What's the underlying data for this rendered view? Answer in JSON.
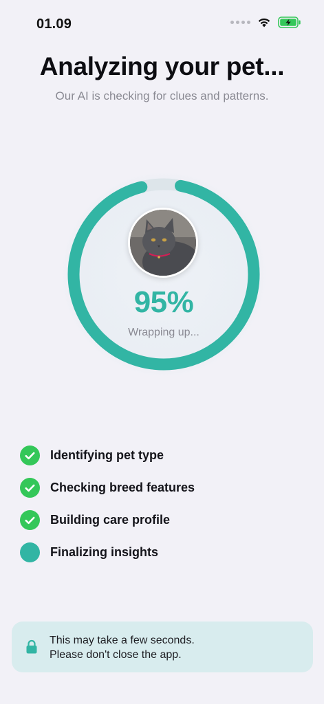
{
  "status_bar": {
    "time": "01.09",
    "icons": [
      "signal-dots-icon",
      "wifi-icon",
      "battery-charging-icon"
    ]
  },
  "header": {
    "title": "Analyzing your pet...",
    "subtitle": "Our AI is checking for clues and patterns."
  },
  "progress": {
    "value": 0.95,
    "percent_text": "95%",
    "status_text": "Wrapping up...",
    "color": "#32b5a4",
    "track_color": "#dde5ea"
  },
  "steps": [
    {
      "label": "Identifying pet type",
      "state": "done",
      "icon": "checkmark-icon"
    },
    {
      "label": "Checking breed features",
      "state": "done",
      "icon": "checkmark-icon"
    },
    {
      "label": "Building care profile",
      "state": "done",
      "icon": "checkmark-icon"
    },
    {
      "label": "Finalizing insights",
      "state": "active",
      "icon": "in-progress-icon"
    }
  ],
  "notice": {
    "icon": "lock-icon",
    "line1": "This may take a few seconds.",
    "line2": "Please don't close the app."
  },
  "colors": {
    "background": "#f2f1f7",
    "done_green": "#34c759",
    "accent_teal": "#32b5a4",
    "notice_bg": "#d8ecee"
  }
}
